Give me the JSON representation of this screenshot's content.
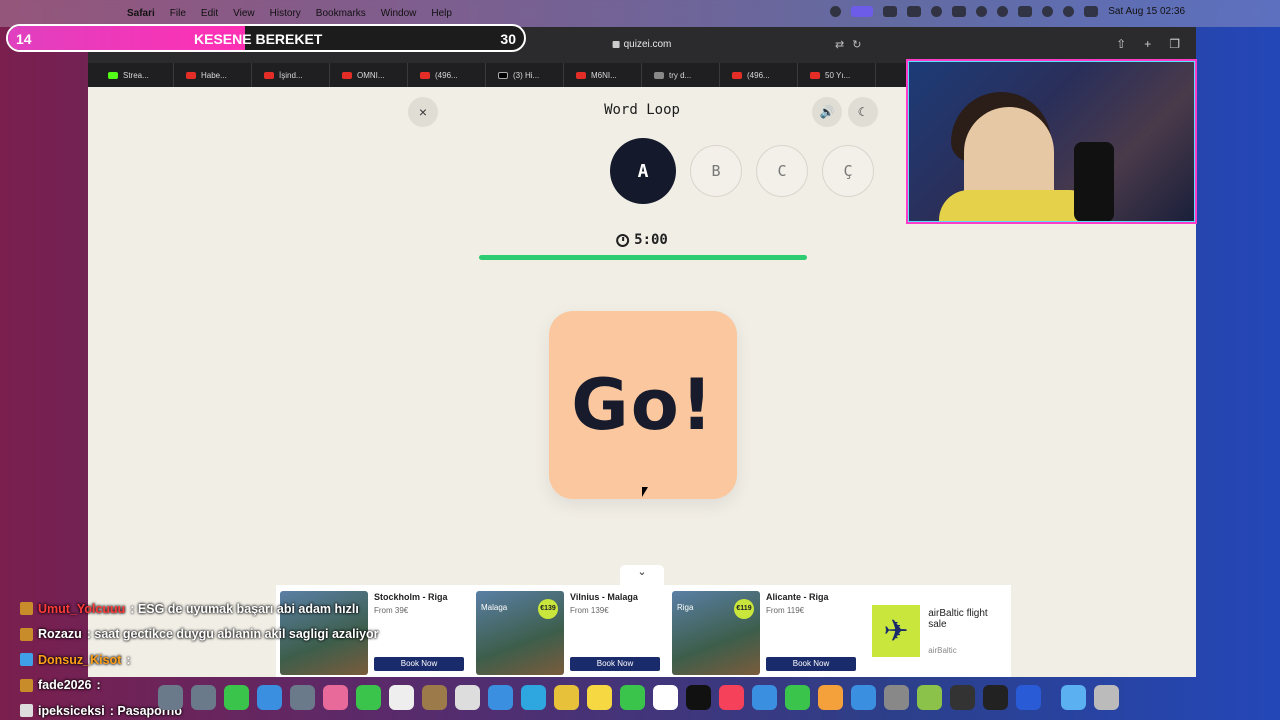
{
  "menubar": {
    "app": "Safari",
    "menus": [
      "File",
      "Edit",
      "View",
      "History",
      "Bookmarks",
      "Window",
      "Help"
    ],
    "clock": "Sat Aug 15  02:36"
  },
  "browser": {
    "url": "quizei.com",
    "tabs": [
      {
        "label": "Strea...",
        "icon": "kick-icon"
      },
      {
        "label": "Habe...",
        "icon": "youtube-icon"
      },
      {
        "label": "İşind...",
        "icon": "youtube-icon"
      },
      {
        "label": "OMNI...",
        "icon": "youtube-icon"
      },
      {
        "label": "(496...",
        "icon": "youtube-icon"
      },
      {
        "label": "(3) Hi...",
        "icon": "x-icon"
      },
      {
        "label": "M6NI...",
        "icon": "youtube-icon"
      },
      {
        "label": "try d...",
        "icon": "generic-icon"
      },
      {
        "label": "(496...",
        "icon": "youtube-icon"
      },
      {
        "label": "50 Yı...",
        "icon": "youtube-icon"
      }
    ]
  },
  "game": {
    "title": "Word Loop",
    "close_icon": "×",
    "sound_icon": "🔊",
    "theme_icon": "☾",
    "letters": [
      {
        "char": "A",
        "active": true
      },
      {
        "char": "B",
        "active": false
      },
      {
        "char": "C",
        "active": false
      },
      {
        "char": "Ç",
        "active": false
      }
    ],
    "timer": "5:00",
    "progress_fraction": 1.0,
    "card_text": "Go!",
    "card_color": "#fac79e",
    "accent_color": "#2ecc71"
  },
  "ads": {
    "collapse_icon": "⌄",
    "items": [
      {
        "title": "Stockholm - Riga",
        "price": "From 39€",
        "button": "Book Now",
        "image_city": "",
        "badge": ""
      },
      {
        "title": "Vilnius - Malaga",
        "price": "From 139€",
        "button": "Book Now",
        "image_city": "Malaga",
        "badge": "€139"
      },
      {
        "title": "Alicante - Riga",
        "price": "From 119€",
        "button": "Book Now",
        "image_city": "Riga",
        "badge": "€119"
      }
    ],
    "promo": {
      "title": "airBaltic flight sale",
      "brand": "airBaltic"
    }
  },
  "overlay": {
    "goal_left": "14",
    "goal_title": "KESENE BEREKET",
    "goal_right": "30",
    "goal_fraction": 0.46,
    "chat": [
      {
        "user": "Umut_Yolcuuu",
        "msg": ": ESG de uyumak başarı abi adam hızlı",
        "color": "#ff3b3b",
        "icon": "gold"
      },
      {
        "user": "Rozazu",
        "msg": ": saat gectikce duygu ablanin akil sagligi azaliyor",
        "color": "#ffffff",
        "icon": "gold"
      },
      {
        "user": "Donsuz_Kisot",
        "msg": ":",
        "color": "#ff9f1a",
        "icon": "blue"
      },
      {
        "user": "fade2026",
        "msg": ":",
        "color": "#ffffff",
        "icon": "gold"
      },
      {
        "user": "ipeksiceksi",
        "msg": ": Pasaporno",
        "color": "#ffffff",
        "icon": "grey"
      }
    ]
  }
}
